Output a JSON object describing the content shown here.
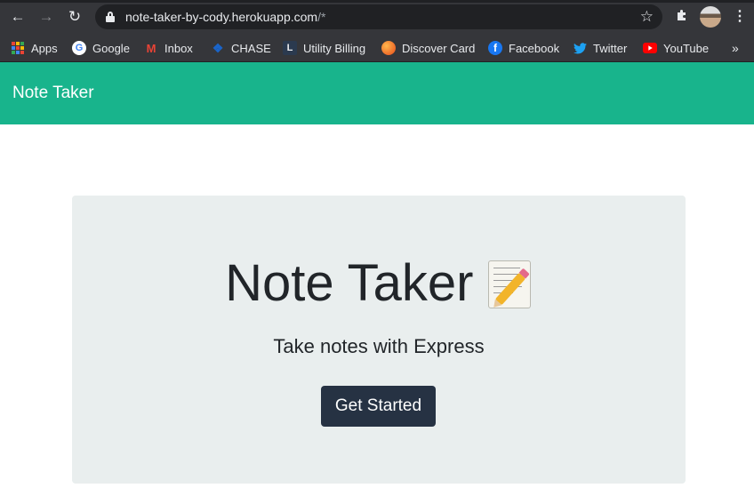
{
  "browser": {
    "url_host": "note-taker-by-cody.herokuapp.com",
    "url_path": "/*",
    "bookmarks": [
      {
        "label": "Apps",
        "icon": "apps-grid-icon"
      },
      {
        "label": "Google",
        "icon": "google-icon"
      },
      {
        "label": "Inbox",
        "icon": "gmail-icon"
      },
      {
        "label": "CHASE",
        "icon": "chase-icon"
      },
      {
        "label": "Utility Billing",
        "icon": "utility-billing-icon"
      },
      {
        "label": "Discover Card",
        "icon": "discover-icon"
      },
      {
        "label": "Facebook",
        "icon": "facebook-icon"
      },
      {
        "label": "Twitter",
        "icon": "twitter-icon"
      },
      {
        "label": "YouTube",
        "icon": "youtube-icon"
      }
    ]
  },
  "navbar": {
    "brand": "Note Taker",
    "color": "#18b48c"
  },
  "hero": {
    "title": "Note Taker",
    "title_icon": "memo-icon",
    "subtitle": "Take notes with Express",
    "button_label": "Get Started",
    "button_color": "#263243",
    "background": "#e9eeee"
  }
}
